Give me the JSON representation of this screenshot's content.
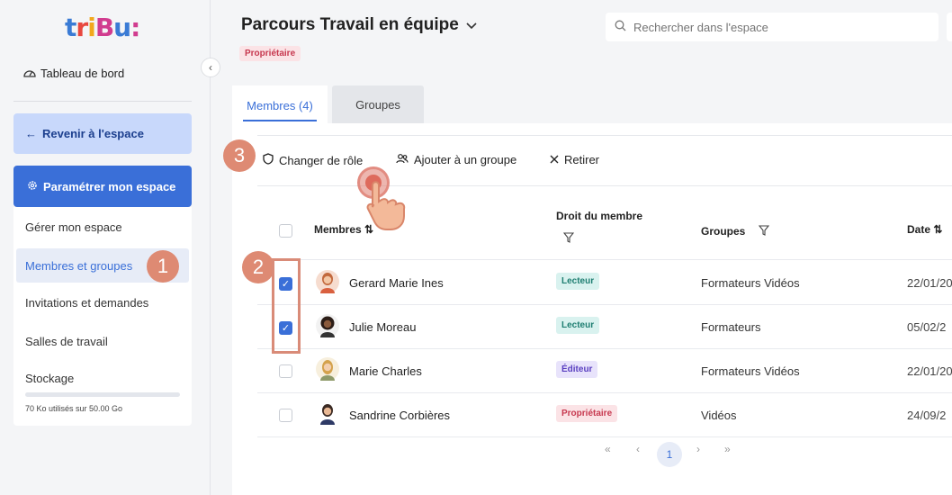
{
  "sidebar": {
    "logo": "tribu:",
    "dashboard": "Tableau de bord",
    "back_label": "Revenir à l'espace",
    "param_label": "Paramétrer mon espace",
    "items": [
      "Gérer mon espace",
      "Membres et groupes",
      "Invitations et demandes",
      "Salles de travail",
      "Stockage"
    ],
    "storage_text": "70 Ko utilisés sur 50.00 Go",
    "storage_fraction": 0.0
  },
  "header": {
    "title": "Parcours Travail en équipe",
    "owner_badge": "Propriétaire",
    "search_placeholder": "Rechercher dans l'espace"
  },
  "tabs": [
    "Membres (4)",
    "Groupes"
  ],
  "toolbar": {
    "change_role": "Changer de rôle",
    "add_group": "Ajouter à un groupe",
    "remove": "Retirer"
  },
  "table": {
    "headers": {
      "members": "Membres",
      "right": "Droit du membre",
      "groups": "Groupes",
      "date": "Date"
    },
    "rows": [
      {
        "name": "Gerard Marie Ines",
        "role": "Lecteur",
        "group": "Formateurs Vidéos",
        "date": "22/01/20",
        "checked": true
      },
      {
        "name": "Julie Moreau",
        "role": "Lecteur",
        "group": "Formateurs",
        "date": "05/02/2",
        "checked": true
      },
      {
        "name": "Marie Charles",
        "role": "Éditeur",
        "group": "Formateurs Vidéos",
        "date": "22/01/20",
        "checked": false
      },
      {
        "name": "Sandrine Corbières",
        "role": "Propriétaire",
        "group": "Vidéos",
        "date": "24/09/2",
        "checked": false
      }
    ]
  },
  "pager": {
    "first": "«",
    "prev": "‹",
    "current": "1",
    "next": "›",
    "last": "»"
  },
  "steps": [
    "1",
    "2",
    "3"
  ],
  "colors": {
    "accent": "#3a6fd8",
    "step": "#de8a73"
  }
}
